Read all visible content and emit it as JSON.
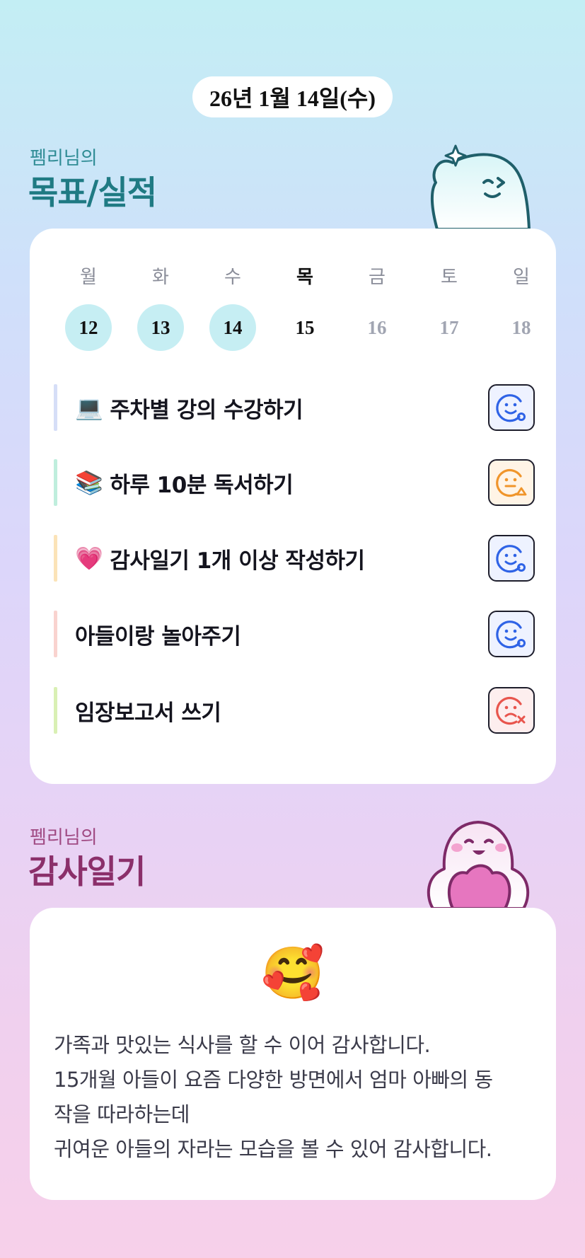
{
  "date": "26년 1월 14일(수)",
  "goals_section": {
    "owner": "펨리님의",
    "title": "목표/실적"
  },
  "week": {
    "days": [
      {
        "label": "월",
        "num": "12"
      },
      {
        "label": "화",
        "num": "13"
      },
      {
        "label": "수",
        "num": "14"
      },
      {
        "label": "목",
        "num": "15"
      },
      {
        "label": "금",
        "num": "16"
      },
      {
        "label": "토",
        "num": "17"
      },
      {
        "label": "일",
        "num": "18"
      }
    ]
  },
  "goals": [
    {
      "emoji": "💻",
      "text": "주차별 강의 수강하기",
      "status": "done",
      "bar_color": "#d6def7"
    },
    {
      "emoji": "📚",
      "text": "하루 10분 독서하기",
      "status": "partial",
      "bar_color": "#bfeedd"
    },
    {
      "emoji": "💗",
      "text": "감사일기 1개 이상 작성하기",
      "status": "done",
      "bar_color": "#fbe3b8"
    },
    {
      "emoji": "",
      "text": "아들이랑 놀아주기",
      "status": "done",
      "bar_color": "#f9d3cf"
    },
    {
      "emoji": "",
      "text": "임장보고서 쓰기",
      "status": "failed",
      "bar_color": "#d9f0b4"
    }
  ],
  "diary_section": {
    "owner": "펨리님의",
    "title": "감사일기"
  },
  "diary": {
    "emoji": "🥰",
    "lines": [
      "가족과 맛있는 식사를 할 수 이어 감사합니다.",
      "15개월 아들이 요즘 다양한 방면에서 엄마 아빠의 동",
      "작을 따라하는데",
      "귀여운 아들의 자라는 모습을 볼 수 있어 감사합니다."
    ]
  },
  "colors": {
    "teal": "#1f7a83",
    "plum": "#8b2f6a",
    "done_blue": "#2f63e6",
    "partial_orange": "#f0952b",
    "failed_red": "#e8554d",
    "today_circle": "#c6eef3"
  }
}
